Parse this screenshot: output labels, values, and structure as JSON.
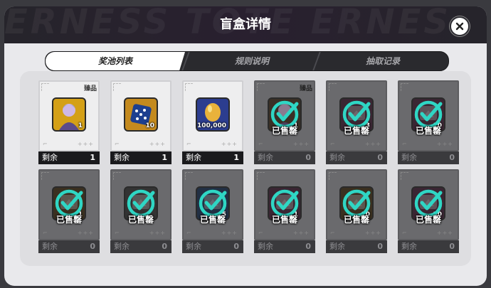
{
  "header": {
    "title": "盲盒详情",
    "watermark": "ERNESS TOTE  ERNES"
  },
  "tabs": [
    {
      "label": "奖池列表",
      "active": true
    },
    {
      "label": "规则说明",
      "active": false
    },
    {
      "label": "抽取记录",
      "active": false
    }
  ],
  "common": {
    "remain_label": "剩余",
    "sold_out_label": "已售罄",
    "precious_label": "臻品"
  },
  "items": [
    {
      "icon": "character-portrait-icon",
      "qty": "1",
      "remain": "1",
      "sold_out": false,
      "precious": true,
      "bg": "#d4a017"
    },
    {
      "icon": "dice-icon",
      "qty": "10",
      "remain": "1",
      "sold_out": false,
      "precious": false,
      "bg": "#c48a1e"
    },
    {
      "icon": "golden-egg-icon",
      "qty": "100,000",
      "remain": "1",
      "sold_out": false,
      "precious": false,
      "bg": "#2c3d8f"
    },
    {
      "icon": "character-portrait-icon",
      "qty": "1",
      "remain": "0",
      "sold_out": true,
      "precious": true,
      "bg": "#3a3026"
    },
    {
      "icon": "item-icon",
      "qty": "3",
      "remain": "0",
      "sold_out": true,
      "precious": false,
      "bg": "#3a2633"
    },
    {
      "icon": "item-icon",
      "qty": "10",
      "remain": "0",
      "sold_out": true,
      "precious": false,
      "bg": "#3a2633"
    },
    {
      "icon": "item-icon",
      "qty": "1",
      "remain": "0",
      "sold_out": true,
      "precious": false,
      "bg": "#3a3020"
    },
    {
      "icon": "item-icon",
      "qty": "",
      "remain": "0",
      "sold_out": true,
      "precious": false,
      "bg": "#333"
    },
    {
      "icon": "item-icon",
      "qty": "5",
      "remain": "0",
      "sold_out": true,
      "precious": false,
      "bg": "#223044"
    },
    {
      "icon": "item-icon",
      "qty": "1",
      "remain": "0",
      "sold_out": true,
      "precious": false,
      "bg": "#3a2633"
    },
    {
      "icon": "item-icon",
      "qty": "10",
      "remain": "0",
      "sold_out": true,
      "precious": false,
      "bg": "#3a3020"
    },
    {
      "icon": "item-icon",
      "qty": "30",
      "remain": "0",
      "sold_out": true,
      "precious": false,
      "bg": "#3a2633"
    }
  ],
  "colors": {
    "sold_check": "#2fd6c4",
    "title_bar": "#1f1d24"
  }
}
